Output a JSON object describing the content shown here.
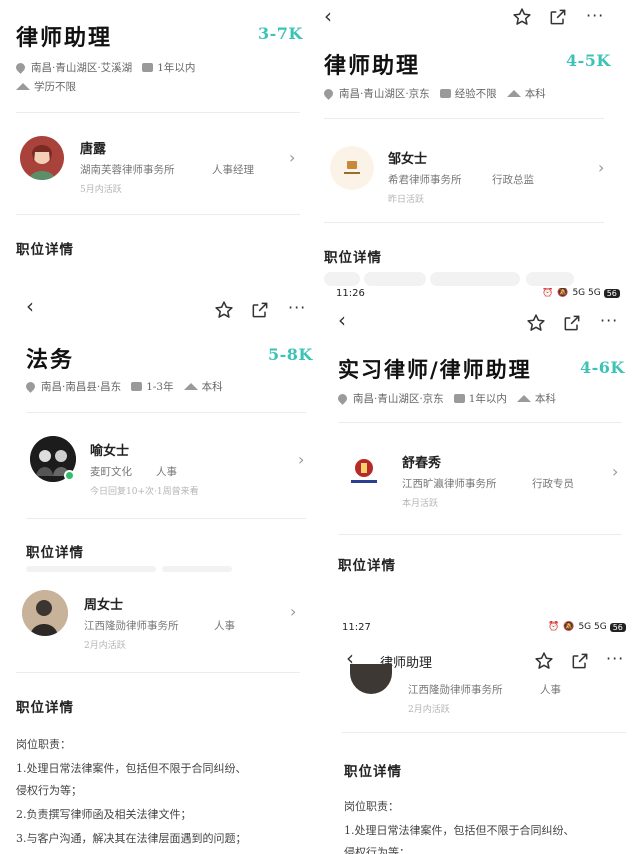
{
  "panel1": {
    "title": "律师助理",
    "salary": "3-7K",
    "location": "南昌·青山湖区·艾溪湖",
    "experience": "1年以内",
    "education": "学历不限",
    "recruiter": {
      "name": "唐露",
      "org": "湖南芙蓉律师事务所",
      "role": "人事经理",
      "active": "5月内活跃"
    },
    "section": "职位详情"
  },
  "panel2": {
    "title": "律师助理",
    "salary": "4-5K",
    "location": "南昌·青山湖区·京东",
    "experience": "经验不限",
    "education": "本科",
    "recruiter": {
      "name": "邹女士",
      "org": "希君律师事务所",
      "role": "行政总监",
      "active": "昨日活跃"
    },
    "section": "职位详情"
  },
  "panel3": {
    "title": "法务",
    "salary": "5-8K",
    "location": "南昌·南昌县·昌东",
    "experience": "1-3年",
    "education": "本科",
    "recruiter1": {
      "name": "喻女士",
      "org": "麦町文化",
      "role": "人事",
      "active": "今日回复10+次·1周曾来看"
    },
    "section1": "职位详情",
    "recruiter2": {
      "name": "周女士",
      "org": "江西隆勋律师事务所",
      "role": "人事",
      "active": "2月内活跃"
    },
    "section2": "职位详情",
    "desc_heading": "岗位职责：",
    "desc_lines": [
      "1.处理日常法律案件，包括但不限于合同纠纷、",
      "侵权行为等；",
      "2.负责撰写律师函及相关法律文件；",
      "3.与客户沟通，解决其在法律层面遇到的问题；"
    ]
  },
  "panel4": {
    "time": "11:26",
    "title": "实习律师/律师助理",
    "salary": "4-6K",
    "location": "南昌·青山湖区·京东",
    "experience": "1年以内",
    "education": "本科",
    "recruiter": {
      "name": "舒春秀",
      "org": "江西旷瀛律师事务所",
      "role": "行政专员",
      "active": "本月活跃"
    },
    "section": "职位详情"
  },
  "panel5": {
    "time": "11:27",
    "header_title": "律师助理",
    "recruiter": {
      "org": "江西隆勋律师事务所",
      "role": "人事",
      "active": "2月内活跃"
    },
    "section": "职位详情",
    "desc_heading": "岗位职责：",
    "desc_lines": [
      "1.处理日常法律案件，包括但不限于合同纠纷、",
      "侵权行为等；"
    ]
  },
  "status_icons": "5G 5G",
  "battery": "56",
  "colors": {
    "salary": "#3cc3b5",
    "text": "#222222",
    "muted": "#777777"
  }
}
